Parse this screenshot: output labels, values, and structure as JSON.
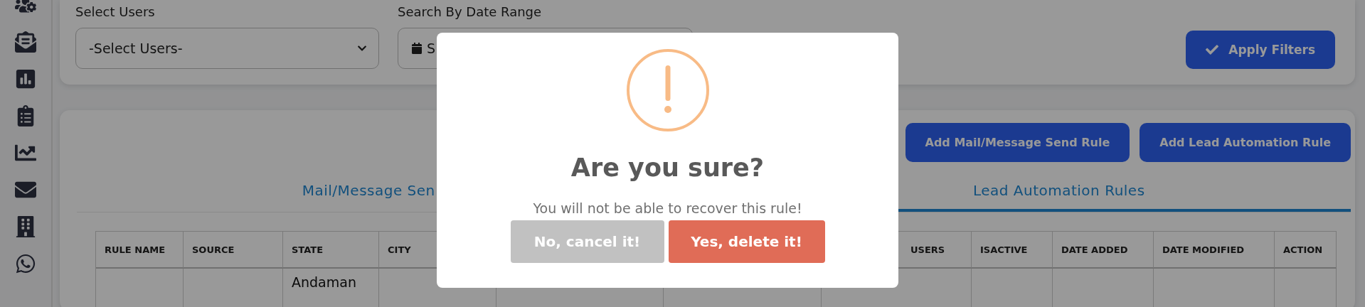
{
  "filters": {
    "users": {
      "label": "Select Users",
      "value": "-Select Users-"
    },
    "date_range": {
      "label": "Search By Date Range",
      "value": "S"
    },
    "apply_button": "Apply Filters"
  },
  "actions": [
    "Add Mail/Message Send Rule",
    "Add Lead Automation Rule"
  ],
  "tabs": [
    {
      "label": "Mail/Message Sen",
      "selected": false
    },
    {
      "label": "Lead Automation Rules",
      "selected": true
    }
  ],
  "table": {
    "columns": [
      "RULE NAME",
      "SOURCE",
      "STATE",
      "CITY",
      "",
      "",
      "USERS",
      "ISACTIVE",
      "DATE ADDED",
      "DATE MODIFIED",
      "ACTION"
    ],
    "rows": [
      [
        "",
        "",
        "Andaman",
        "",
        "",
        "",
        "",
        "",
        "",
        "",
        ""
      ]
    ]
  },
  "dialog": {
    "title": "Are you sure?",
    "message": "You will not be able to recover this rule!",
    "cancel": "No, cancel it!",
    "confirm": "Yes, delete it!"
  }
}
